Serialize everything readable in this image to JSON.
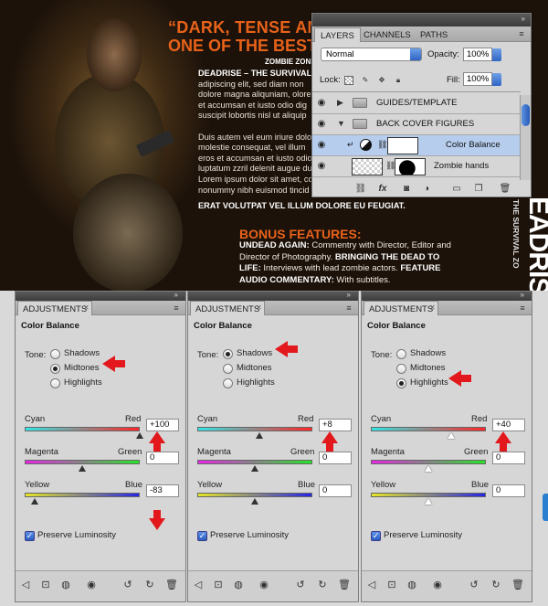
{
  "poster": {
    "headline1": "“DARK, TENSE AND",
    "headline2": "ONE OF THE BEST ZO",
    "headline_sub": "ZOMBIE ZONE",
    "body_title": "DEADRISE – THE SURVIVAL",
    "body_lines": [
      "adipiscing elit, sed diam non",
      "dolore magna aliquniam, olore",
      "et accumsan et iusto odio dig",
      "suscipit lobortis nisl ut aliquip",
      "",
      "Duis autem vel eum iriure dolo",
      "molestie consequat, vel illum",
      "eros et accumsan et iusto odio",
      "luptatum zzril delenit augue du",
      "Lorem ipsum dolor sit amet, co",
      "nonummy nibh euismod tincid"
    ],
    "body_end": "ERAT VOLUTPAT VEL ILLUM DOLORE EU FEUGIAT.",
    "bonus_title": "BONUS FEATURES:",
    "bonus_p1_bold": "UNDEAD AGAIN:",
    "bonus_p1": " Commentry with Director, Editor and Director of Photography. ",
    "bonus_p2_bold": "BRINGING THE DEAD TO LIFE:",
    "bonus_p2": " Interviews with lead zombie actors. ",
    "bonus_p3_bold": "FEATURE AUDIO COMMENTARY:",
    "bonus_p3": " With subtitles.",
    "vertical_title": "EADRIS",
    "vertical_sub": "THE SURVIVAL ZO"
  },
  "layers": {
    "tabs": [
      "LAYERS",
      "CHANNELS",
      "PATHS"
    ],
    "blend_mode": "Normal",
    "opacity_label": "Opacity:",
    "opacity_value": "100%",
    "lock_label": "Lock:",
    "fill_label": "Fill:",
    "fill_value": "100%",
    "items": [
      {
        "name": "GUIDES/TEMPLATE",
        "type": "group",
        "expanded": false
      },
      {
        "name": "BACK COVER FIGURES",
        "type": "group",
        "expanded": true
      },
      {
        "name": "Color Balance",
        "type": "adjustment",
        "selected": true
      },
      {
        "name": "Zombie hands",
        "type": "layer"
      }
    ]
  },
  "adjustments": [
    {
      "tab": "ADJUSTMENTS",
      "panel_title": "Color Balance",
      "tone_label": "Tone:",
      "tones": [
        "Shadows",
        "Midtones",
        "Highlights"
      ],
      "selected_tone": "Midtones",
      "sliders": [
        {
          "left": "Cyan",
          "right": "Red",
          "value": "+100",
          "level": 100
        },
        {
          "left": "Magenta",
          "right": "Green",
          "value": "0",
          "level": 0
        },
        {
          "left": "Yellow",
          "right": "Blue",
          "value": "-83",
          "level": -83
        }
      ],
      "preserve_label": "Preserve Luminosity"
    },
    {
      "tab": "ADJUSTMENTS",
      "panel_title": "Color Balance",
      "tone_label": "Tone:",
      "tones": [
        "Shadows",
        "Midtones",
        "Highlights"
      ],
      "selected_tone": "Shadows",
      "sliders": [
        {
          "left": "Cyan",
          "right": "Red",
          "value": "+8",
          "level": 8
        },
        {
          "left": "Magenta",
          "right": "Green",
          "value": "0",
          "level": 0
        },
        {
          "left": "Yellow",
          "right": "Blue",
          "value": "0",
          "level": 0
        }
      ],
      "preserve_label": "Preserve Luminosity"
    },
    {
      "tab": "ADJUSTMENTS",
      "panel_title": "Color Balance",
      "tone_label": "Tone:",
      "tones": [
        "Shadows",
        "Midtones",
        "Highlights"
      ],
      "selected_tone": "Highlights",
      "sliders": [
        {
          "left": "Cyan",
          "right": "Red",
          "value": "+40",
          "level": 40
        },
        {
          "left": "Magenta",
          "right": "Green",
          "value": "0",
          "level": 0
        },
        {
          "left": "Yellow",
          "right": "Blue",
          "value": "0",
          "level": 0
        }
      ],
      "preserve_label": "Preserve Luminosity"
    }
  ],
  "colors": {
    "annotation_arrow": "#e2181c",
    "headline_orange": "#e8621a",
    "selection_blue": "#b6cdee"
  }
}
